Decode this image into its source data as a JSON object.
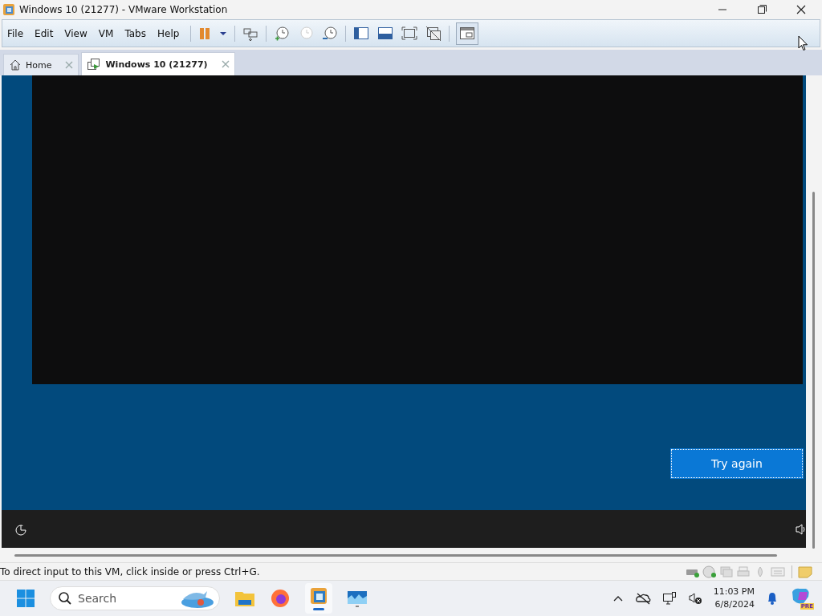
{
  "window": {
    "title": "Windows 10 (21277) - VMware Workstation"
  },
  "menu": [
    "File",
    "Edit",
    "View",
    "VM",
    "Tabs",
    "Help"
  ],
  "tabs": [
    {
      "label": "Home",
      "selected": false
    },
    {
      "label": "Windows 10 (21277)",
      "selected": true
    }
  ],
  "vm_screen": {
    "button": "Try again"
  },
  "status_bar": {
    "text": "To direct input to this VM, click inside or press Ctrl+G."
  },
  "taskbar": {
    "search": {
      "placeholder": "Search"
    },
    "clock": {
      "time": "11:03 PM",
      "date": "6/8/2024"
    },
    "badge": "PRE"
  }
}
